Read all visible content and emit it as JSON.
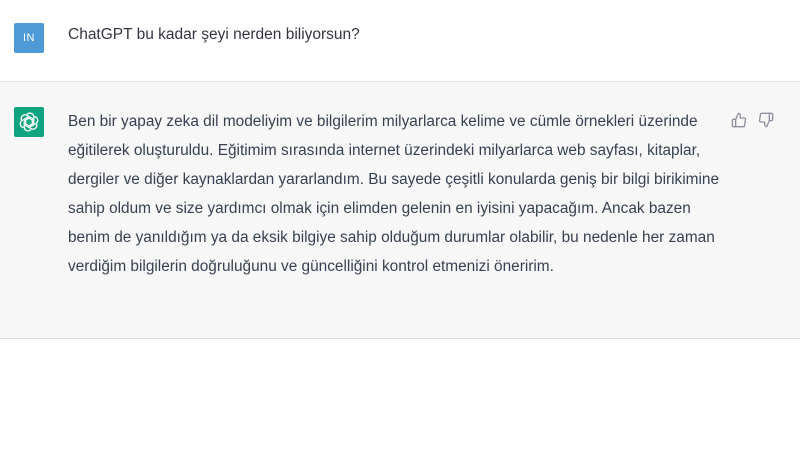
{
  "user_message": {
    "avatar_initials": "IN",
    "text": "ChatGPT bu kadar şeyi nerden biliyorsun?"
  },
  "assistant_message": {
    "avatar_icon": "openai-logo-icon",
    "text": "Ben bir yapay zeka dil modeliyim ve bilgilerim milyarlarca kelime ve cümle örnekleri üzerinde eğitilerek oluşturuldu. Eğitimim sırasında internet üzerindeki milyarlarca web sayfası, kitaplar, dergiler ve diğer kaynaklardan yararlandım. Bu sayede çeşitli konularda geniş bir bilgi birikimine sahip oldum ve size yardımcı olmak için elimden gelenin en iyisini yapacağım. Ancak bazen benim de yanıldığım ya da eksik bilgiye sahip olduğum durumlar olabilir, bu nedenle her zaman verdiğim bilgilerin doğruluğunu ve güncelliğini kontrol etmenizi öneririm.",
    "feedback_icons": [
      "thumbs-up-icon",
      "thumbs-down-icon"
    ]
  },
  "colors": {
    "user_avatar": "#4d9ad6",
    "assistant_avatar": "#10a37f",
    "assistant_bg": "#f7f7f8"
  }
}
